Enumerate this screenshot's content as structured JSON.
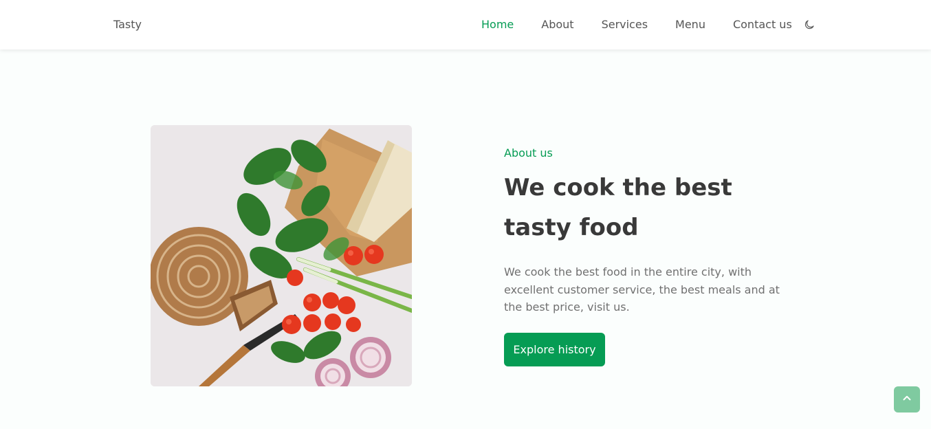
{
  "header": {
    "logo": "Tasty",
    "nav": [
      {
        "label": "Home",
        "active": true
      },
      {
        "label": "About",
        "active": false
      },
      {
        "label": "Services",
        "active": false
      },
      {
        "label": "Menu",
        "active": false
      },
      {
        "label": "Contact us",
        "active": false
      }
    ],
    "theme_icon": "moon-icon"
  },
  "about": {
    "subtitle": "About us",
    "title": "We cook the best tasty food",
    "description": "We cook the best food in the entire city, with excellent customer service, the best meals and at the best price, visit us.",
    "button_label": "Explore history",
    "image_icon": "food-photo"
  },
  "scroll_top_icon": "chevron-up-icon",
  "colors": {
    "accent": "#069c54",
    "title": "#393939",
    "text": "#707070",
    "background": "#fbfefd"
  }
}
